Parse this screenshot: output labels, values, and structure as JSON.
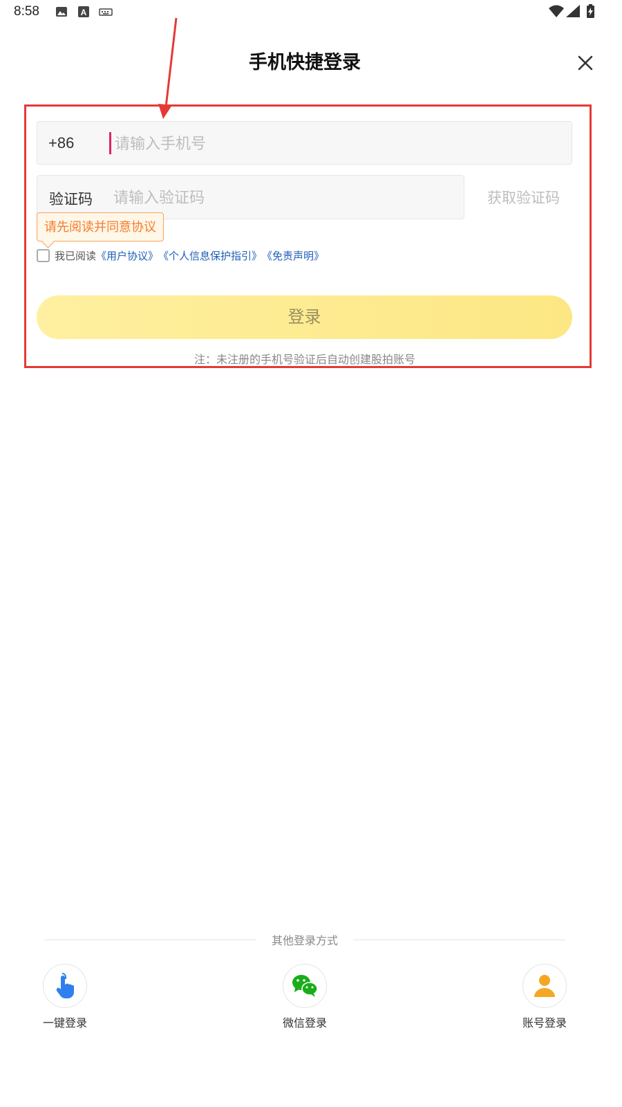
{
  "status_bar": {
    "time": "8:58",
    "icons": [
      "image-icon",
      "a-icon",
      "keyboard-icon",
      "wifi-icon",
      "signal-icon",
      "battery-charging-icon"
    ]
  },
  "header": {
    "title": "手机快捷登录",
    "close_icon": "close-icon"
  },
  "form": {
    "phone_prefix": "+86",
    "phone_placeholder": "请输入手机号",
    "code_label": "验证码",
    "code_placeholder": "请输入验证码",
    "get_code_label": "获取验证码",
    "tooltip": "请先阅读并同意协议",
    "agreement_prefix": "我已阅读",
    "agreement_links": [
      "《用户协议》",
      "《个人信息保护指引》",
      "《免责声明》"
    ],
    "login_label": "登录",
    "note": "注：未注册的手机号验证后自动创建股拍账号"
  },
  "other_login": {
    "label": "其他登录方式",
    "options": [
      {
        "label": "一键登录",
        "icon": "tap-hand-icon",
        "color": "#2f80ed"
      },
      {
        "label": "微信登录",
        "icon": "wechat-icon",
        "color": "#1aad19"
      },
      {
        "label": "账号登录",
        "icon": "user-icon",
        "color": "#f5a623"
      }
    ]
  },
  "colors": {
    "annotation": "#e53935",
    "link": "#1f5fb8",
    "tooltip_text": "#f57c2b",
    "login_button": "#fde784"
  }
}
